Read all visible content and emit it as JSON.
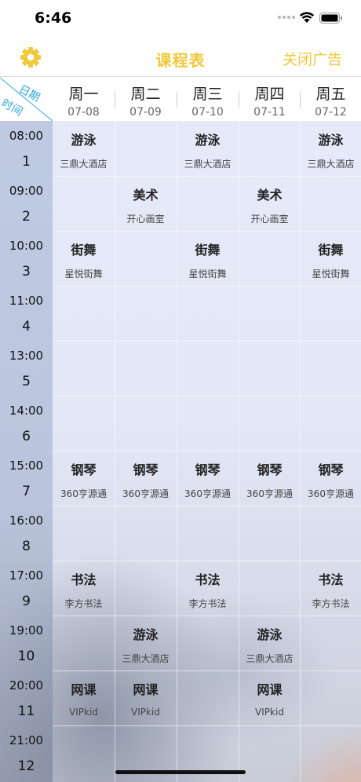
{
  "status": {
    "time": "6:46"
  },
  "nav": {
    "title": "课程表",
    "close_ad": "关闭广告"
  },
  "corner": {
    "date_label": "日期",
    "time_label": "时间"
  },
  "days": [
    {
      "name": "周一",
      "date": "07-08"
    },
    {
      "name": "周二",
      "date": "07-09"
    },
    {
      "name": "周三",
      "date": "07-10"
    },
    {
      "name": "周四",
      "date": "07-11"
    },
    {
      "name": "周五",
      "date": "07-12"
    }
  ],
  "slots": [
    {
      "time": "08:00",
      "num": "1"
    },
    {
      "time": "09:00",
      "num": "2"
    },
    {
      "time": "10:00",
      "num": "3"
    },
    {
      "time": "11:00",
      "num": "4"
    },
    {
      "time": "13:00",
      "num": "5"
    },
    {
      "time": "14:00",
      "num": "6"
    },
    {
      "time": "15:00",
      "num": "7"
    },
    {
      "time": "16:00",
      "num": "8"
    },
    {
      "time": "17:00",
      "num": "9"
    },
    {
      "time": "19:00",
      "num": "10"
    },
    {
      "time": "20:00",
      "num": "11"
    },
    {
      "time": "21:00",
      "num": "12"
    }
  ],
  "courses": [
    {
      "slot": 1,
      "day": 1,
      "name": "游泳",
      "location": "三鼎大酒店"
    },
    {
      "slot": 1,
      "day": 3,
      "name": "游泳",
      "location": "三鼎大酒店"
    },
    {
      "slot": 1,
      "day": 5,
      "name": "游泳",
      "location": "三鼎大酒店"
    },
    {
      "slot": 2,
      "day": 2,
      "name": "美术",
      "location": "开心画室"
    },
    {
      "slot": 2,
      "day": 4,
      "name": "美术",
      "location": "开心画室"
    },
    {
      "slot": 3,
      "day": 1,
      "name": "街舞",
      "location": "星悦街舞"
    },
    {
      "slot": 3,
      "day": 3,
      "name": "街舞",
      "location": "星悦街舞"
    },
    {
      "slot": 3,
      "day": 5,
      "name": "街舞",
      "location": "星悦街舞"
    },
    {
      "slot": 7,
      "day": 1,
      "name": "钢琴",
      "location": "360亨源通"
    },
    {
      "slot": 7,
      "day": 2,
      "name": "钢琴",
      "location": "360亨源通"
    },
    {
      "slot": 7,
      "day": 3,
      "name": "钢琴",
      "location": "360亨源通"
    },
    {
      "slot": 7,
      "day": 4,
      "name": "钢琴",
      "location": "360亨源通"
    },
    {
      "slot": 7,
      "day": 5,
      "name": "钢琴",
      "location": "360亨源通"
    },
    {
      "slot": 9,
      "day": 1,
      "name": "书法",
      "location": "李方书法"
    },
    {
      "slot": 9,
      "day": 3,
      "name": "书法",
      "location": "李方书法"
    },
    {
      "slot": 9,
      "day": 5,
      "name": "书法",
      "location": "李方书法"
    },
    {
      "slot": 10,
      "day": 2,
      "name": "游泳",
      "location": "三鼎大酒店"
    },
    {
      "slot": 10,
      "day": 4,
      "name": "游泳",
      "location": "三鼎大酒店"
    },
    {
      "slot": 11,
      "day": 1,
      "name": "网课",
      "location": "VIPkid"
    },
    {
      "slot": 11,
      "day": 2,
      "name": "网课",
      "location": "VIPkid"
    },
    {
      "slot": 11,
      "day": 4,
      "name": "网课",
      "location": "VIPkid"
    }
  ],
  "colors": {
    "accent": "#f0c93a",
    "corner_text": "#2fa8e0"
  },
  "icons": {
    "settings": "gear-icon",
    "wifi": "wifi-icon",
    "battery": "battery-icon"
  }
}
